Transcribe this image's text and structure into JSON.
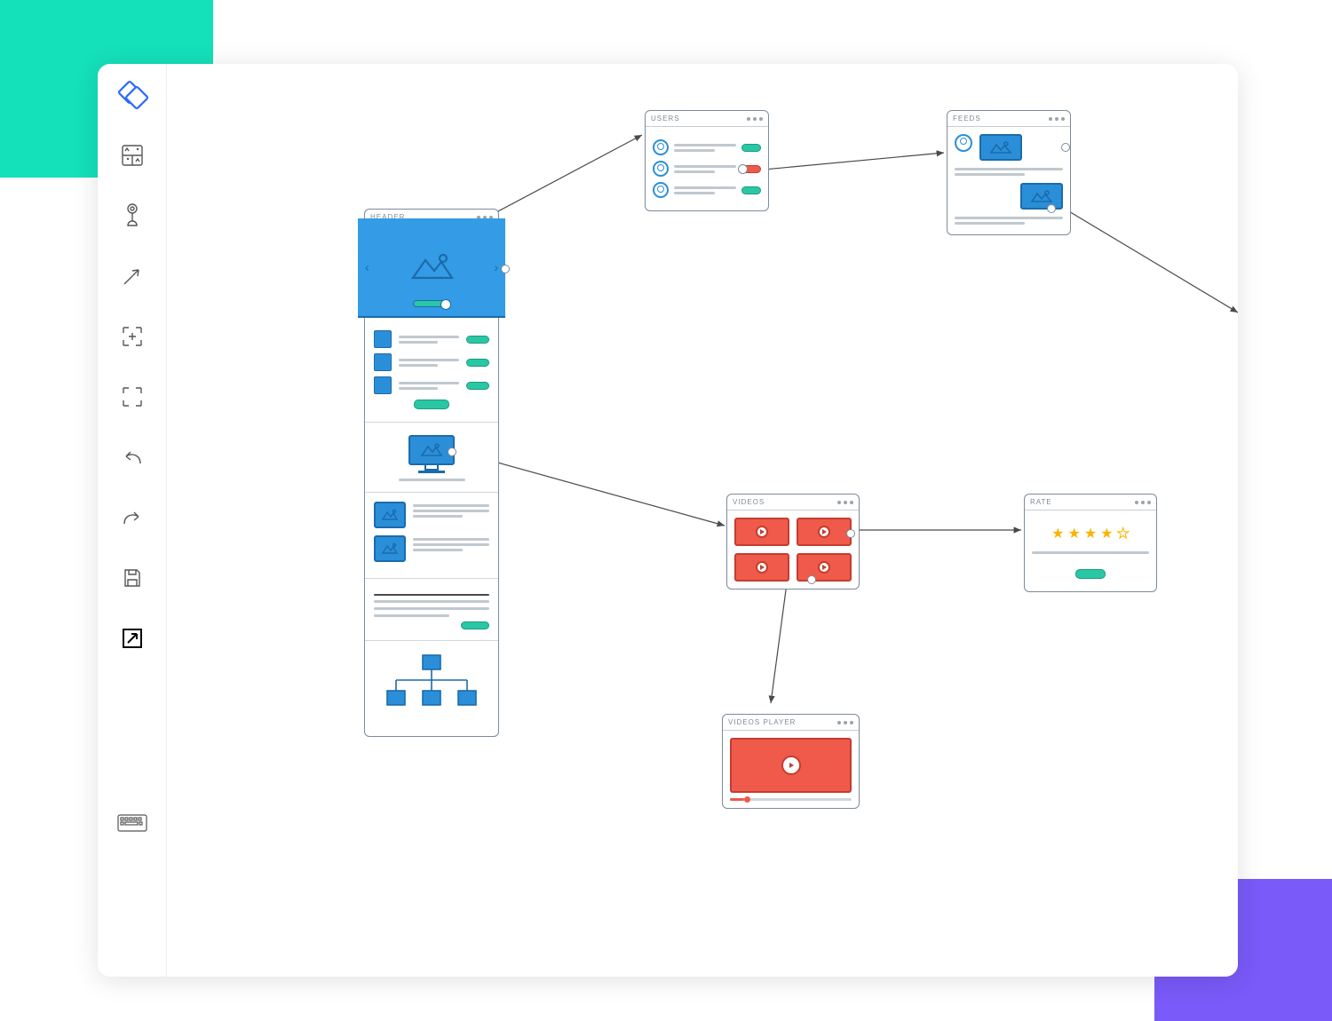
{
  "toolbar": {
    "items": [
      {
        "name": "logo",
        "interact": false
      },
      {
        "name": "templates-icon",
        "interact": true
      },
      {
        "name": "hand-touch-icon",
        "interact": true
      },
      {
        "name": "arrow-cursor-icon",
        "interact": true
      },
      {
        "name": "crosshair-add-icon",
        "interact": true
      },
      {
        "name": "crop-icon",
        "interact": true
      },
      {
        "name": "undo-icon",
        "interact": true
      },
      {
        "name": "redo-icon",
        "interact": true
      },
      {
        "name": "save-icon",
        "interact": true
      },
      {
        "name": "export-icon",
        "interact": true,
        "active": true
      },
      {
        "name": "keyboard-icon",
        "interact": true
      }
    ]
  },
  "cards": {
    "header": {
      "title": "HEADER"
    },
    "users": {
      "title": "USERS"
    },
    "feeds": {
      "title": "FEEDS"
    },
    "videos": {
      "title": "VIDEOS"
    },
    "video_player": {
      "title": "VIDEOS PLAYER"
    },
    "rate": {
      "title": "RATE",
      "stars_filled": 4,
      "stars_total": 5
    }
  },
  "colors": {
    "teal_bg": "#14e0b9",
    "purple_bg": "#7a5af8",
    "wire_blue": "#2a8fd8",
    "wire_green": "#2ac7a5",
    "wire_red": "#ef5a4a"
  }
}
